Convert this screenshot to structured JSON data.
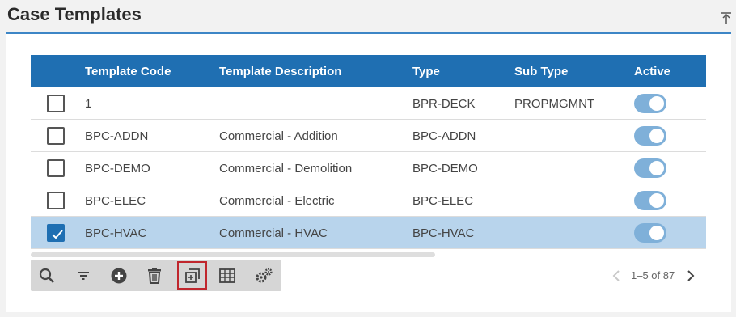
{
  "page": {
    "title": "Case Templates"
  },
  "table": {
    "headers": {
      "code": "Template Code",
      "description": "Template Description",
      "type": "Type",
      "subtype": "Sub Type",
      "active": "Active"
    },
    "rows": [
      {
        "code": "1",
        "description": "",
        "type": "BPR-DECK",
        "subtype": "PROPMGMNT",
        "active": true,
        "checked": false
      },
      {
        "code": "BPC-ADDN",
        "description": "Commercial - Addition",
        "type": "BPC-ADDN",
        "subtype": "",
        "active": true,
        "checked": false
      },
      {
        "code": "BPC-DEMO",
        "description": "Commercial - Demolition",
        "type": "BPC-DEMO",
        "subtype": "",
        "active": true,
        "checked": false
      },
      {
        "code": "BPC-ELEC",
        "description": "Commercial - Electric",
        "type": "BPC-ELEC",
        "subtype": "",
        "active": true,
        "checked": false
      },
      {
        "code": "BPC-HVAC",
        "description": "Commercial - HVAC",
        "type": "BPC-HVAC",
        "subtype": "",
        "active": true,
        "checked": true
      }
    ]
  },
  "toolbar": {
    "buttons": [
      "search-icon",
      "filter-icon",
      "add-icon",
      "delete-icon",
      "copy-icon",
      "columns-icon",
      "settings-icon"
    ],
    "highlighted": "copy-icon"
  },
  "pager": {
    "text": "1–5 of 87"
  },
  "colors": {
    "header_bg": "#1f6fb2",
    "accent": "#3d86c6",
    "selected_row": "#b8d4ec",
    "toggle_on": "#7fb0d9",
    "highlight": "#c0262d"
  }
}
